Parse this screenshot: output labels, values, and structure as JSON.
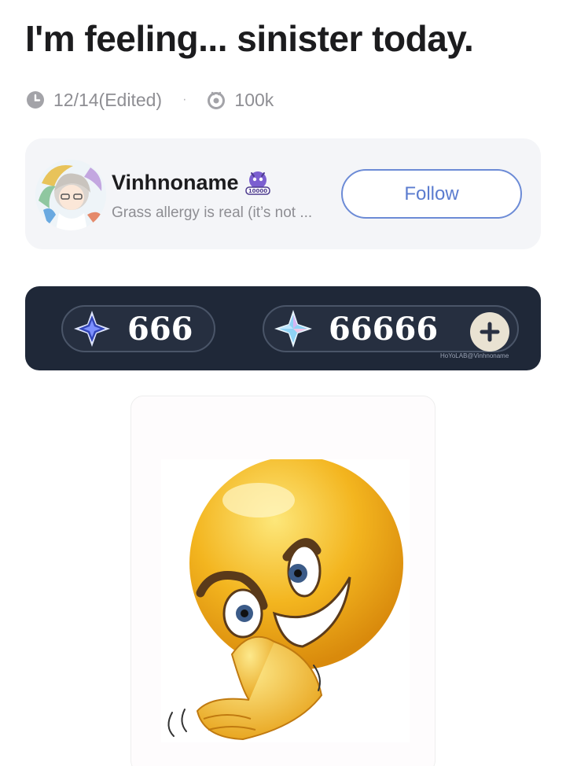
{
  "post": {
    "title": "I'm feeling... sinister today.",
    "date": "12/14(Edited)",
    "views": "100k"
  },
  "author": {
    "name": "Vinhnoname",
    "bio": "Grass allergy is real (it’s not ...",
    "follow_label": "Follow",
    "badge_icon": "milestone-badge-icon"
  },
  "currency": {
    "primary_value": "666",
    "secondary_value": "66666",
    "watermark": "HoYoLAB@Vinhnoname",
    "primary_icon": "intertwined-fate-icon",
    "secondary_icon": "primogem-icon",
    "add_icon": "plus-icon"
  },
  "image": {
    "subject": "sinister-emoji-icon"
  },
  "colors": {
    "accent": "#5b7ccf",
    "banner_bg": "#1f2838",
    "card_bg": "#f4f5f8",
    "emoji_yellow": "#f3b51f"
  }
}
